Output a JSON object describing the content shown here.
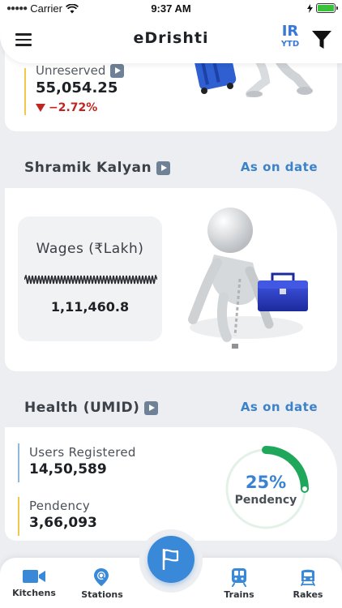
{
  "status_bar": {
    "carrier": "Carrier",
    "time": "9:37 AM",
    "icons": [
      "signal-dots-icon",
      "wifi-icon",
      "battery-charging-icon"
    ],
    "battery_color": "#39c13b"
  },
  "header": {
    "title": "eDrishti",
    "menu_icon": "hamburger-menu-icon",
    "badge_top": "IR",
    "badge_bottom": "YTD",
    "filter_icon": "filter-funnel-icon",
    "accent_color": "#3a78d8"
  },
  "unreserved": {
    "label": "Unreserved",
    "value": "55,054.25",
    "change": "−2.72%",
    "change_color": "#c0261f",
    "illustration": "luggage-figure-illustration"
  },
  "shramik": {
    "title": "Shramik Kalyan",
    "date_link": "As on date",
    "wages_label": "Wages (₹Lakh)",
    "wages_value": "1,11,460.8",
    "illustration": "worker-with-toolbox-illustration"
  },
  "health": {
    "title": "Health (UMID)",
    "date_link": "As on date",
    "users_label": "Users Registered",
    "users_value": "14,50,589",
    "pendency_label": "Pendency",
    "pendency_value": "3,66,093",
    "donut_percent": "25%",
    "donut_label": "Pendency",
    "donut_fraction": 0.25,
    "donut_color": "#1fa85b",
    "users_bar_color": "#8fb8e0",
    "pendency_bar_color": "#f2c94c"
  },
  "bottom_nav": {
    "items": [
      {
        "label": "Kitchens",
        "icon": "video-camera-icon"
      },
      {
        "label": "Stations",
        "icon": "map-search-icon"
      },
      {
        "label": "Trains",
        "icon": "train-icon"
      },
      {
        "label": "Rakes",
        "icon": "rake-train-icon"
      }
    ],
    "fab_icon": "flag-icon",
    "fab_color": "#3a88d8"
  }
}
